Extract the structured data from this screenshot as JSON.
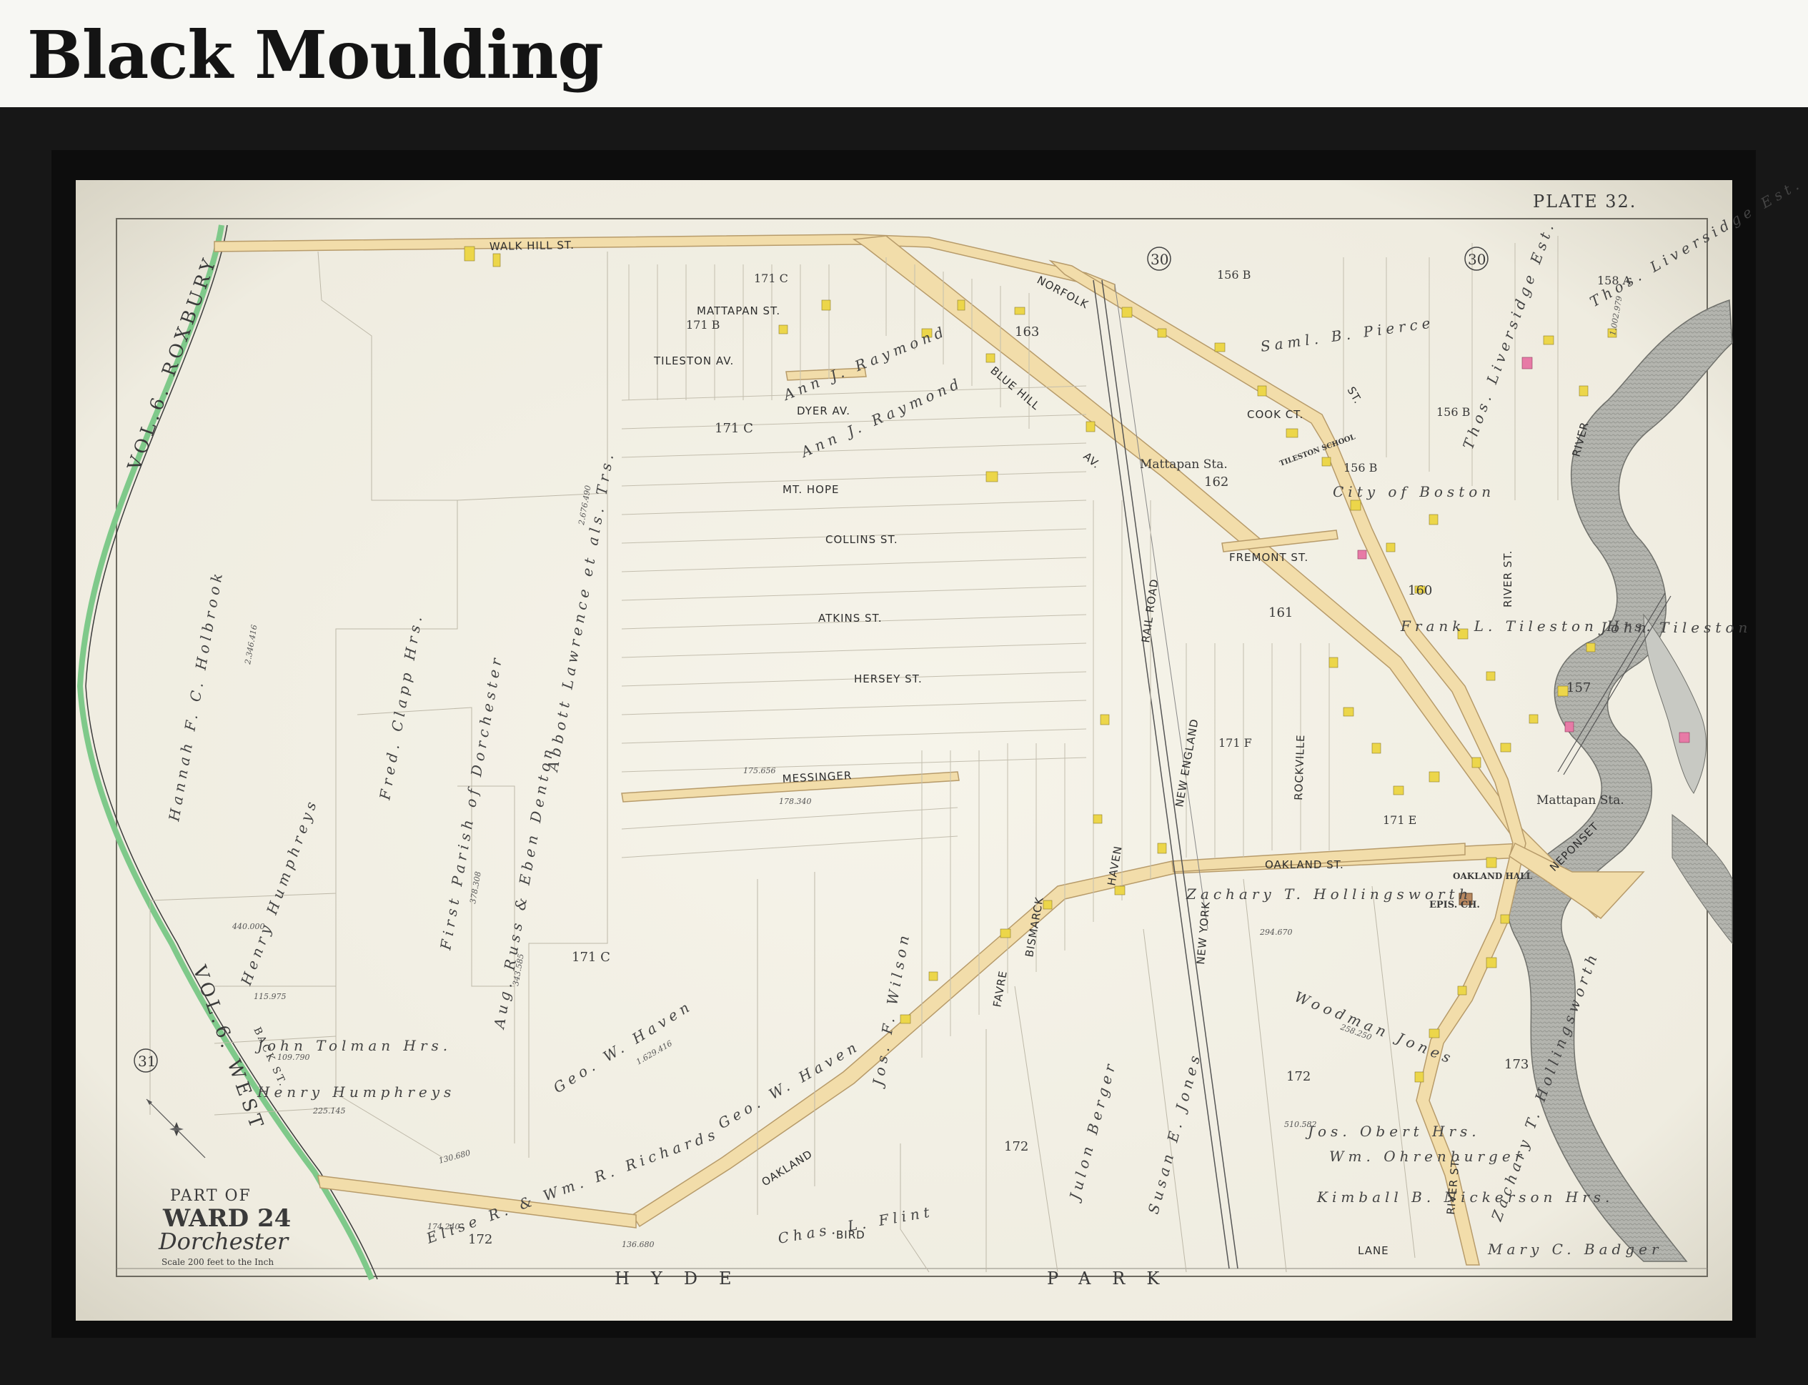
{
  "header": {
    "title": "Black Moulding"
  },
  "map": {
    "plate": "PLATE 32.",
    "cartouche": {
      "line1": "PART OF",
      "line2": "WARD 24",
      "line3": "Dorchester",
      "scale": "Scale 200 feet to the Inch"
    },
    "bottom_label_left": "HYDE",
    "bottom_label_right": "PARK",
    "plate_refs": [
      "30",
      "30",
      "31"
    ],
    "side_labels": {
      "left_top": "VOL.6. ROXBURY",
      "left_bottom": "VOL.6. WEST",
      "back_st": "BACK ST."
    },
    "streets": [
      "WALK HILL ST.",
      "NORFOLK",
      "BLUE HILL",
      "AV.",
      "MATTAPAN ST.",
      "TILESTON AV.",
      "DYER AV.",
      "MT. HOPE",
      "COLLINS ST.",
      "ATKINS ST.",
      "HERSEY ST.",
      "MESSINGER",
      "OAKLAND ST.",
      "OAKLAND",
      "BIRD",
      "LANE",
      "COOK CT.",
      "FREMONT ST.",
      "RIVER ST.",
      "BISMARCK",
      "FAVRE",
      "HAVEN",
      "NEW ENGLAND",
      "NEW YORK",
      "RAIL ROAD",
      "ROCKVILLE",
      "RIVER",
      "NEPONSET",
      "RIVER ST.",
      "ST."
    ],
    "lot_numbers": [
      "171 C",
      "171 B",
      "171 C",
      "171 C",
      "156 B",
      "156 B",
      "156 B",
      "158 A",
      "162",
      "163",
      "160",
      "161",
      "157",
      "171 F",
      "171 E",
      "172",
      "172",
      "172",
      "173"
    ],
    "stations": [
      "Mattapan Sta.",
      "Mattapan Sta."
    ],
    "landmarks": [
      "TILESTON SCHOOL",
      "OAKLAND HALL",
      "EPIS. CH."
    ],
    "owners": [
      "Hannah F. C. Holbrook",
      "Abbott Lawrence et als. Trs.",
      "Ann J. Raymond",
      "Ann J. Raymond",
      "First Parish of Dorchester",
      "Aug. Russ & Eben Denton",
      "Fred. Clapp Hrs.",
      "Henry Humphreys",
      "John Tolman Hrs.",
      "Henry Humphreys",
      "Geo. W. Haven",
      "Geo. W. Haven",
      "Jos. F. Wilson",
      "Elise R. & Wm. R. Richards",
      "Chas. L. Flint",
      "Julon Berger",
      "Susan E. Jones",
      "Zachary T. Hollingsworth",
      "Woodman Jones",
      "Saml. B. Pierce",
      "City of Boston",
      "Thos. Liversidge Est.",
      "Kimball B. Nickerson Hrs.",
      "Zachary T. Hollingsworth",
      "Jos. Obert Hrs.",
      "Wm. Ohrenburger",
      "John Tileston",
      "Frank L. Tileston Hrs.",
      "Thos. Liversidge Est.",
      "Mary C. Badger"
    ],
    "areas": [
      "2.346.416",
      "440.000",
      "115.975",
      "109.790",
      "225.145",
      "1.629.416",
      "294.670",
      "130.680",
      "174.240",
      "136.680",
      "258.250",
      "510.582",
      "2.676.490",
      "378.308",
      "343.585",
      "178.340",
      "175.656",
      "1.002.979"
    ]
  },
  "colors": {
    "frame": "#171717",
    "paper": "#f4f1e6",
    "road": "#f2ddaa",
    "building": "#ecd64a",
    "church": "#e77aa6",
    "river": "#a9aaa6",
    "boundary_green": "#7fc98a"
  }
}
